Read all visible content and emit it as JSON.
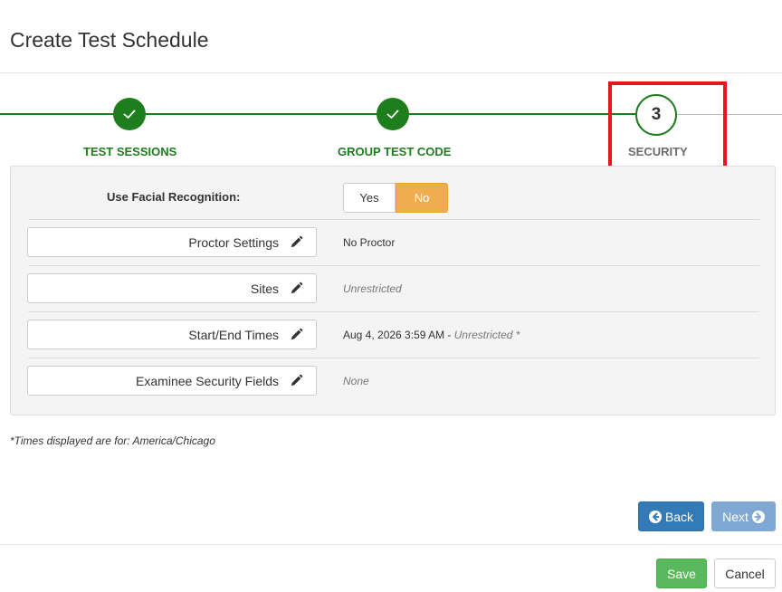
{
  "page": {
    "title": "Create Test Schedule"
  },
  "stepper": {
    "steps": [
      {
        "label": "TEST SESSIONS",
        "status": "complete",
        "icon": "check-icon"
      },
      {
        "label": "GROUP TEST CODE",
        "status": "complete",
        "icon": "check-icon"
      },
      {
        "label": "SECURITY",
        "number": "3",
        "status": "current"
      }
    ],
    "complete_color": "#1e7e1e",
    "highlight_color": "#e8161c"
  },
  "facial_recognition": {
    "label": "Use Facial Recognition:",
    "options": [
      "Yes",
      "No"
    ],
    "selected": "No",
    "selected_color": "#f0ad4e"
  },
  "rows": [
    {
      "button": "Proctor Settings",
      "value": "No Proctor",
      "icon": "pencil-icon"
    },
    {
      "button": "Sites",
      "value": "Unrestricted",
      "icon": "pencil-icon"
    },
    {
      "button": "Start/End Times",
      "value_date": "Aug 4, 2026 3:59 AM",
      "value_sep": " - ",
      "value_end": "Unrestricted",
      "value_mark": " *",
      "icon": "pencil-icon"
    },
    {
      "button": "Examinee Security Fields",
      "value": "None",
      "icon": "pencil-icon"
    }
  ],
  "note": "*Times displayed are for: America/Chicago",
  "nav": {
    "back": "Back",
    "next": "Next",
    "back_icon": "arrow-circle-left-icon",
    "next_icon": "arrow-circle-right-icon"
  },
  "footer": {
    "save": "Save",
    "cancel": "Cancel"
  }
}
